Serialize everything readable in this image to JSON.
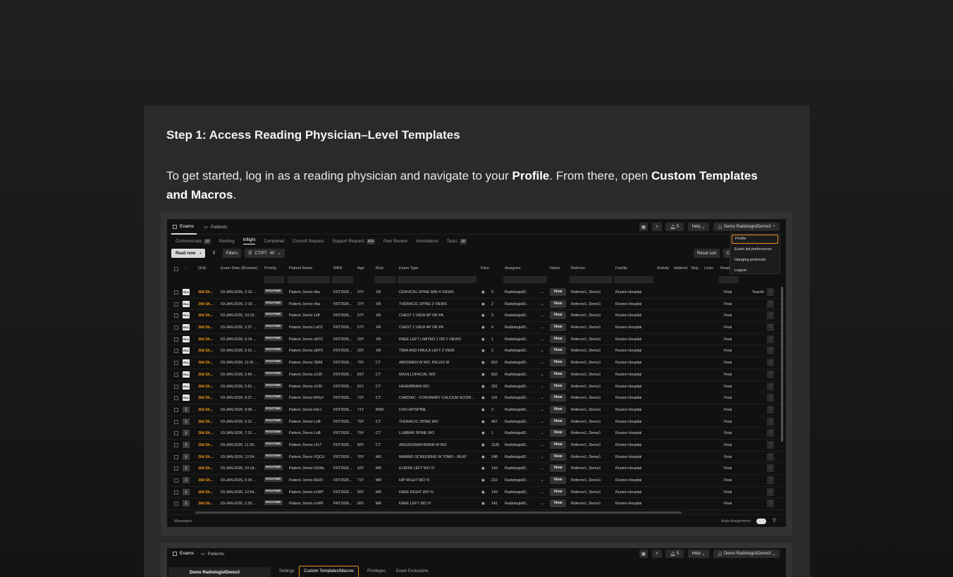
{
  "article": {
    "title": "Step 1: Access Reading Physician–Level Templates",
    "body_prefix": "To get started, log in as a reading physician and navigate to your ",
    "body_profile": "Profile",
    "body_mid": ". From there, open ",
    "body_custom": "Custom Templates and Macros",
    "body_end": "."
  },
  "app": {
    "top_tabs": [
      "Exams",
      "Patients"
    ],
    "notifications_count": "5",
    "help_label": "Help",
    "user_label": "Demo RadiologistDemo3",
    "sub_tabs": [
      {
        "label": "Communicate",
        "count": "10"
      },
      {
        "label": "Pending",
        "count": ""
      },
      {
        "label": "Inflight",
        "count": ""
      },
      {
        "label": "Completed",
        "count": ""
      },
      {
        "label": "Consult Request",
        "count": ""
      },
      {
        "label": "Support Request",
        "count": "414"
      },
      {
        "label": "Peer Review",
        "count": ""
      },
      {
        "label": "Annotations",
        "count": ""
      },
      {
        "label": "Tasks",
        "count": "18"
      }
    ],
    "read_now": "Read now",
    "filters": "Filters",
    "ctpt_label": "CT/PT",
    "ctpt_count": "40",
    "reset_sort": "Reset sort",
    "reset_sort_more": "C",
    "columns": {
      "due": "DUE",
      "exam_date": "Exam Date (Browser)",
      "priority": "Priority",
      "patient": "Patient Name",
      "mrn": "MRN",
      "age": "Age",
      "mod": "Mod",
      "exam_type": "Exam Type",
      "files": "Files",
      "assignee": "Assignee",
      "notes": "Notes",
      "referrer": "Referrer",
      "facility": "Facility",
      "activity": "Activity",
      "addend": "Addend",
      "skip": "Skip",
      "links": "Links",
      "read": "Read"
    },
    "dropdown": [
      "Profile",
      "Exam list preferences",
      "Hanging protocols",
      "Logout"
    ],
    "rows": [
      {
        "badge": "ALL",
        "due": "30d 5h...",
        "date": "03-JAN-2026, 2:19 ...",
        "pri": "ROUTINE",
        "patient": "Patient, Demo rlba",
        "mrn": "FRT2026...",
        "age": "37Y",
        "mod": "XR",
        "exam": "CERVICAL SPINE MIN 4 VIEWS",
        "files": "5",
        "assignee": "RadiologistD...",
        "view": "View",
        "ref": "Referrer1, Demo1",
        "fac": "Runion Hospital",
        "status": "Final",
        "extra": "Teachir"
      },
      {
        "badge": "ALL",
        "due": "30d 5h...",
        "date": "03-JAN-2026, 2:19 ...",
        "pri": "ROUTINE",
        "patient": "Patient, Demo rlba",
        "mrn": "FRT2026...",
        "age": "37Y",
        "mod": "XR",
        "exam": "THORACIC SPINE 2 VIEWS",
        "files": "2",
        "assignee": "RadiologistD...",
        "view": "View",
        "ref": "Referrer1, Demo1",
        "fac": "Runion Hospital",
        "status": "Final",
        "extra": ""
      },
      {
        "badge": "ALL",
        "due": "30d 5h...",
        "date": "03-JAN-2026, 10:10...",
        "pri": "ROUTINE",
        "patient": "Patient, Demo 1elf",
        "mrn": "FRT2026...",
        "age": "57Y",
        "mod": "XR",
        "exam": "CHEST 1 VIEW AP OR PA",
        "files": "3",
        "assignee": "RadiologistD...",
        "view": "View",
        "ref": "Referrer1, Demo1",
        "fac": "Runion Hospital",
        "status": "Final",
        "extra": ""
      },
      {
        "badge": "ALL",
        "due": "30d 5h...",
        "date": "03-JAN-2026, 2:37 ...",
        "pri": "ROUTINE",
        "patient": "Patient, Demo LeDZ",
        "mrn": "FRT2026...",
        "age": "67Y",
        "mod": "XR",
        "exam": "CHEST 1 VIEW AP OR PA",
        "files": "4",
        "assignee": "RadiologistD...",
        "view": "View",
        "ref": "Referrer1, Demo1",
        "fac": "Runion Hospital",
        "status": "Final",
        "extra": ""
      },
      {
        "badge": "ALL",
        "due": "30d 5h...",
        "date": "03-JAN-2026, 6:14 ...",
        "pri": "ROUTINE",
        "patient": "Patient, Demo sEPC",
        "mrn": "FRT2026...",
        "age": "32Y",
        "mod": "XR",
        "exam": "KNEE LEFT LIMITED 1 OR 2 VIEWS",
        "files": "1",
        "assignee": "RadiologistD...",
        "view": "View",
        "ref": "Referrer1, Demo1",
        "fac": "Runion Hospital",
        "status": "Final",
        "extra": ""
      },
      {
        "badge": "ALL",
        "due": "30d 5h...",
        "date": "03-JAN-2026, 5:51 ...",
        "pri": "ROUTINE",
        "patient": "Patient, Demo sEPC",
        "mrn": "FRT2026...",
        "age": "32Y",
        "mod": "XR",
        "exam": "TIBIA AND FIBULA LEFT 2 VIEW",
        "files": "3",
        "assignee": "RadiologistD...",
        "view": "View",
        "ref": "Referrer1, Demo1",
        "fac": "Runion Hospital",
        "status": "Final",
        "extra": ""
      },
      {
        "badge": "ALL",
        "due": "30d 5h...",
        "date": "03-JAN-2026, 11:41 ...",
        "pri": "ROUTINE",
        "patient": "Patient, Demo 7jRM",
        "mrn": "FRT2026...",
        "age": "79Y",
        "mod": "CT",
        "exam": "ABDOMEN W WO, PELVIS W",
        "files": "653",
        "assignee": "RadiologistD...",
        "view": "View",
        "ref": "Referrer1, Demo1",
        "fac": "Runion Hospital",
        "status": "Final",
        "extra": ""
      },
      {
        "badge": "ALL",
        "due": "30d 5h...",
        "date": "03-JAN-2026, 5:54 ...",
        "pri": "ROUTINE",
        "patient": "Patient, Demo zX39",
        "mrn": "FRT2026...",
        "age": "81Y",
        "mod": "CT",
        "exam": "MAXILLOFACIAL WO",
        "files": "562",
        "assignee": "RadiologistD...",
        "view": "View",
        "ref": "Referrer1, Demo1",
        "fac": "Runion Hospital",
        "status": "Final",
        "extra": ""
      },
      {
        "badge": "ALL",
        "due": "30d 5h...",
        "date": "03-JAN-2026, 5:51 ...",
        "pri": "ROUTINE",
        "patient": "Patient, Demo zX39",
        "mrn": "FRT2026...",
        "age": "81Y",
        "mod": "CT",
        "exam": "HEAD/BRAIN WO",
        "files": "281",
        "assignee": "RadiologistD...",
        "view": "View",
        "ref": "Referrer1, Demo1",
        "fac": "Runion Hospital",
        "status": "Final",
        "extra": ""
      },
      {
        "badge": "ALL",
        "due": "30d 5h...",
        "date": "03-JAN-2026, 8:37 ...",
        "pri": "ROUTINE",
        "patient": "Patient, Demo MRyV",
        "mrn": "FRT2026...",
        "age": "72Y",
        "mod": "CT",
        "exam": "CARDIAC - CORONARY CALCIUM SCORI...",
        "files": "116",
        "assignee": "RadiologistD...",
        "view": "View",
        "ref": "Referrer1, Demo1",
        "fac": "Runion Hospital",
        "status": "Final",
        "extra": ""
      },
      {
        "badge": "⤓",
        "due": "30d 5h...",
        "date": "03-JAN-2026, 9:06 ...",
        "pri": "ROUTINE",
        "patient": "Patient, Demo 6dc1",
        "mrn": "FRT2026...",
        "age": "71Y",
        "mod": "BMD",
        "exam": "DXA HIP/SPINE",
        "files": "2",
        "assignee": "RadiologistD...",
        "view": "View",
        "ref": "Referrer1, Demo1",
        "fac": "Runion Hospital",
        "status": "Final",
        "extra": ""
      },
      {
        "badge": "⤓",
        "due": "30d 5h...",
        "date": "03-JAN-2026, 5:31 ...",
        "pri": "ROUTINE",
        "patient": "Patient, Demo Lzl8",
        "mrn": "FRT2026...",
        "age": "79Y",
        "mod": "CT",
        "exam": "THORACIC SPINE WO",
        "files": "467",
        "assignee": "RadiologistD...",
        "view": "View",
        "ref": "Referrer1, Demo1",
        "fac": "Runion Hospital",
        "status": "Final",
        "extra": ""
      },
      {
        "badge": "⤓",
        "due": "30d 5h...",
        "date": "03-JAN-2026, 7:31 ...",
        "pri": "ROUTINE",
        "patient": "Patient, Demo Lzl8",
        "mrn": "FRT2026...",
        "age": "79Y",
        "mod": "CT",
        "exam": "LUMBAR SPINE WO",
        "files": "1",
        "assignee": "RadiologistD...",
        "view": "View",
        "ref": "Referrer1, Demo1",
        "fac": "Runion Hospital",
        "status": "Final",
        "extra": ""
      },
      {
        "badge": "⤓",
        "due": "30d 5h...",
        "date": "03-JAN-2026, 11:39...",
        "pri": "ROUTINE",
        "patient": "Patient, Demo LlIc7",
        "mrn": "FRT2026...",
        "age": "83Y",
        "mod": "CT",
        "exam": "ANGIOGRAM BRAIN W WO",
        "files": "1135",
        "assignee": "RadiologistD...",
        "view": "View",
        "ref": "Referrer1, Demo1",
        "fac": "Runion Hospital",
        "status": "Final",
        "extra": ""
      },
      {
        "badge": "⤓",
        "due": "30d 5h...",
        "date": "03-JAN-2026, 12:54...",
        "pri": "ROUTINE",
        "patient": "Patient, Demo VQCU",
        "mrn": "FRT2026...",
        "age": "70Y",
        "mod": "MG",
        "exam": "MAMMO SCREENING W TOMO - BILAT",
        "files": "248",
        "assignee": "RadiologistD...",
        "view": "View",
        "ref": "Referrer1, Demo1",
        "fac": "Runion Hospital",
        "status": "Final",
        "extra": ""
      },
      {
        "badge": "⤓",
        "due": "30d 5h...",
        "date": "03-JAN-2026, 10:18...",
        "pri": "ROUTINE",
        "patient": "Patient, Demo CKWu",
        "mrn": "FRT2026...",
        "age": "62Y",
        "mod": "MR",
        "exam": "ELBOW LEFT WO IV",
        "files": "143",
        "assignee": "RadiologistD...",
        "view": "View",
        "ref": "Referrer1, Demo1",
        "fac": "Runion Hospital",
        "status": "Final",
        "extra": ""
      },
      {
        "badge": "⤓",
        "due": "30d 5h...",
        "date": "03-JAN-2026, 6:34 ...",
        "pri": "ROUTINE",
        "patient": "Patient, Demo 6RZ0",
        "mrn": "FRT2026...",
        "age": "71Y",
        "mod": "MR",
        "exam": "HIP RIGHT WO IV",
        "files": "222",
        "assignee": "RadiologistD...",
        "view": "View",
        "ref": "Referrer1, Demo1",
        "fac": "Runion Hospital",
        "status": "Final",
        "extra": ""
      },
      {
        "badge": "⤓",
        "due": "30d 5h...",
        "date": "03-JAN-2026, 12:54...",
        "pri": "ROUTINE",
        "patient": "Patient, Demo zvWP",
        "mrn": "FRT2026...",
        "age": "56Y",
        "mod": "MR",
        "exam": "KNEE RIGHT WO IV",
        "files": "143",
        "assignee": "RadiologistD...",
        "view": "View",
        "ref": "Referrer1, Demo1",
        "fac": "Runion Hospital",
        "status": "Final",
        "extra": ""
      },
      {
        "badge": "⤓",
        "due": "30d 5h...",
        "date": "03-JAN-2026, 1:03 ...",
        "pri": "ROUTINE",
        "patient": "Patient, Demo zvWP",
        "mrn": "FRT2026...",
        "age": "56Y",
        "mod": "MR",
        "exam": "KNEE LEFT WO IV",
        "files": "141",
        "assignee": "RadiologistD...",
        "view": "View",
        "ref": "Referrer1, Demo1",
        "fac": "Runion Hospital",
        "status": "Final",
        "extra": ""
      }
    ],
    "footer_messages": "Messages",
    "auto_assignment": "Auto-Assignment"
  },
  "app2": {
    "top_tabs": [
      "Exams",
      "Patients"
    ],
    "help_label": "Help",
    "user_label": "Demo RadiologistDemo3",
    "notifications_count": "5",
    "profile_name": "Demo RadiologistDemo3",
    "tabs": [
      "Settings",
      "Custom Templates/Macros",
      "Privileges",
      "Exam Exclusions"
    ]
  },
  "colors": {
    "accent_orange": "#e8921a",
    "due_orange": "#f59a1a",
    "bg": "#1a1a1a"
  }
}
